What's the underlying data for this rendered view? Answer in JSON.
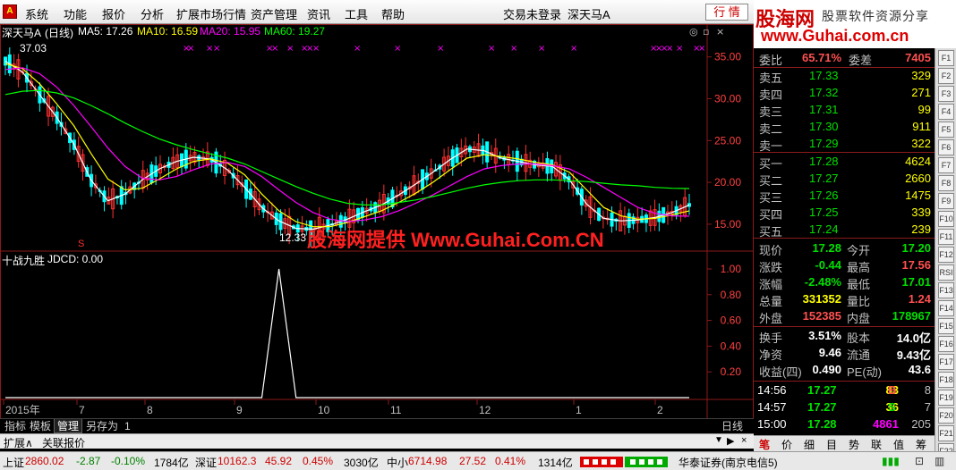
{
  "menu": {
    "app_icon": "A",
    "items": [
      "系统",
      "功能",
      "报价",
      "分析",
      "扩展市场行情",
      "资产管理",
      "资讯",
      "工具",
      "帮助"
    ],
    "trade_status": "交易未登录",
    "stock_name": "深天马A",
    "hq_button": "行 情"
  },
  "banner": {
    "logo": "股海网",
    "slogan": "股票软件资源分享",
    "url": "www.Guhai.com.cn"
  },
  "main_chart": {
    "stock_label": "深天马A",
    "period": "(日线)",
    "ma5_label": "MA5: 17.26",
    "ma10_label": "MA10: 16.59",
    "ma20_label": "MA20: 15.95",
    "ma60_label": "MA60: 19.27",
    "high_mark": "37.03",
    "low_mark": "12.33",
    "watermark": "股海网提供 Www.Guhai.Com.CN",
    "s_marker": "S"
  },
  "chart_data": [
    {
      "type": "line",
      "title": "深天马A (日线)",
      "y_ticks": [
        "35.00",
        "30.00",
        "25.00",
        "20.00",
        "15.00"
      ],
      "ylim": [
        12,
        37
      ],
      "x_ticks": [
        "2015年",
        "7",
        "8",
        "9",
        "10",
        "11",
        "12",
        "1",
        "2"
      ],
      "max_label": "37.03",
      "min_label": "12.33",
      "series": [
        {
          "name": "MA5",
          "color": "#ffffff",
          "values": [
            34.5,
            33.2,
            30.5,
            27.8,
            24.6,
            20.3,
            17.8,
            18.6,
            20.3,
            21.6,
            22.5,
            23.0,
            22.8,
            21.5,
            19.4,
            17.0,
            15.4,
            14.5,
            14.4,
            14.9,
            15.6,
            16.5,
            17.3,
            18.5,
            19.8,
            21.2,
            22.7,
            24.0,
            23.8,
            22.9,
            22.5,
            22.1,
            21.9,
            20.3,
            17.4,
            15.7,
            15.4,
            15.5,
            15.8,
            16.4,
            17.3
          ]
        },
        {
          "name": "MA10",
          "color": "#ffff00",
          "values": [
            34.2,
            33.6,
            31.8,
            29.4,
            26.8,
            23.5,
            20.4,
            19.1,
            19.3,
            20.4,
            21.6,
            22.5,
            22.8,
            22.3,
            20.9,
            18.6,
            16.6,
            15.3,
            14.7,
            14.7,
            15.2,
            15.9,
            16.6,
            17.6,
            18.7,
            20.0,
            21.5,
            22.9,
            23.3,
            23.1,
            22.8,
            22.4,
            22.1,
            21.2,
            19.1,
            17.0,
            16.0,
            15.6,
            15.7,
            16.1,
            16.6
          ]
        },
        {
          "name": "MA20",
          "color": "#ff00ff",
          "values": [
            33.5,
            33.7,
            33.0,
            31.4,
            29.2,
            26.7,
            24.1,
            21.9,
            20.5,
            20.3,
            20.7,
            21.5,
            22.2,
            22.4,
            21.9,
            20.7,
            19.1,
            17.6,
            16.4,
            15.6,
            15.3,
            15.5,
            15.9,
            16.6,
            17.5,
            18.5,
            19.6,
            20.7,
            21.6,
            22.0,
            22.2,
            22.2,
            22.0,
            21.6,
            20.6,
            19.4,
            18.2,
            17.0,
            16.3,
            16.0,
            15.95
          ]
        },
        {
          "name": "MA60",
          "color": "#00ff00",
          "values": [
            30.5,
            30.9,
            31.0,
            30.7,
            30.1,
            29.2,
            28.2,
            27.1,
            26.1,
            25.2,
            24.5,
            23.9,
            23.4,
            22.9,
            22.2,
            21.3,
            20.4,
            19.5,
            18.7,
            18.0,
            17.5,
            17.3,
            17.3,
            17.6,
            17.9,
            18.3,
            18.8,
            19.3,
            19.7,
            20.0,
            20.2,
            20.3,
            20.3,
            20.2,
            20.1,
            19.9,
            19.7,
            19.6,
            19.4,
            19.3,
            19.27
          ]
        }
      ]
    },
    {
      "type": "line",
      "title": "十战九胜 JDCD: 0.00",
      "y_ticks": [
        "1.00",
        "0.80",
        "0.60",
        "0.40",
        "0.20"
      ],
      "ylim": [
        0,
        1
      ],
      "series": [
        {
          "name": "JDCD",
          "color": "#ffffff",
          "values": [
            0,
            0,
            0,
            0,
            0,
            0,
            0,
            0,
            0,
            0,
            0,
            0,
            0,
            0,
            0,
            0,
            1.0,
            0,
            0,
            0,
            0,
            0,
            0,
            0,
            0,
            0,
            0,
            0,
            0,
            0,
            0,
            0,
            0,
            0,
            0,
            0,
            0,
            0,
            0,
            0,
            0
          ]
        }
      ]
    }
  ],
  "sub_chart": {
    "title": "十战九胜",
    "indicator": "JDCD: 0.00"
  },
  "quote": {
    "weibi_label": "委比",
    "weibi_value": "65.71%",
    "weicha_label": "委差",
    "weicha_value": "7405",
    "asks": [
      {
        "label": "卖五",
        "price": "17.33",
        "vol": "329"
      },
      {
        "label": "卖四",
        "price": "17.32",
        "vol": "271"
      },
      {
        "label": "卖三",
        "price": "17.31",
        "vol": "99"
      },
      {
        "label": "卖二",
        "price": "17.30",
        "vol": "911"
      },
      {
        "label": "卖一",
        "price": "17.29",
        "vol": "322"
      }
    ],
    "bids": [
      {
        "label": "买一",
        "price": "17.28",
        "vol": "4624"
      },
      {
        "label": "买二",
        "price": "17.27",
        "vol": "2660"
      },
      {
        "label": "买三",
        "price": "17.26",
        "vol": "1475"
      },
      {
        "label": "买四",
        "price": "17.25",
        "vol": "339"
      },
      {
        "label": "买五",
        "price": "17.24",
        "vol": "239"
      }
    ],
    "stats": [
      {
        "l1": "现价",
        "v1": "17.28",
        "l2": "今开",
        "v2": "17.20"
      },
      {
        "l1": "涨跌",
        "v1": "-0.44",
        "l2": "最高",
        "v2": "17.56"
      },
      {
        "l1": "涨幅",
        "v1": "-2.48%",
        "l2": "最低",
        "v2": "17.01"
      },
      {
        "l1": "总量",
        "v1": "331352",
        "l2": "量比",
        "v2": "1.24"
      },
      {
        "l1": "外盘",
        "v1": "152385",
        "l2": "内盘",
        "v2": "178967"
      }
    ],
    "fin": [
      {
        "l1": "换手",
        "v1": "3.51%",
        "l2": "股本",
        "v2": "14.0亿"
      },
      {
        "l1": "净资",
        "v1": "9.46",
        "l2": "流通",
        "v2": "9.43亿"
      },
      {
        "l1": "收益(四)",
        "v1": "0.490",
        "l2": "PE(动)",
        "v2": "43.6"
      }
    ],
    "ticks": [
      {
        "time": "14:56",
        "price": "17.27",
        "vol": "83",
        "flag": "B",
        "n": "8"
      },
      {
        "time": "14:57",
        "price": "17.27",
        "vol": "36",
        "flag": "S",
        "n": "7"
      },
      {
        "time": "15:00",
        "price": "17.28",
        "vol": "4861",
        "flag": "",
        "n": "205"
      }
    ]
  },
  "tabs": [
    "指标",
    "模板",
    "管理",
    "另存为",
    "1"
  ],
  "period_label": "日线",
  "ext_bar": {
    "ext": "扩展∧",
    "related": "关联报价"
  },
  "bottom_tabs": [
    "笔",
    "价",
    "细",
    "目",
    "势",
    "联",
    "值",
    "筹"
  ],
  "side_buttons": [
    "F1",
    "F2",
    "F3",
    "F4",
    "F5",
    "F6",
    "F7",
    "F8",
    "F9",
    "F10",
    "F11",
    "F12",
    "RSI",
    "F13",
    "F14",
    "F15",
    "F16",
    "F17",
    "F18",
    "F19",
    "F20",
    "F21",
    "F22"
  ],
  "status": {
    "sh_label": "上证",
    "sh_val": "2860.02",
    "sh_chg": "-2.87",
    "sh_pct": "-0.10%",
    "sh_amt": "1784亿",
    "sz_label": "深证",
    "sz_val": "10162.3",
    "sz_chg": "45.92",
    "sz_pct": "0.45%",
    "sz_amt": "3030亿",
    "zx_label": "中小",
    "zx_val": "6714.98",
    "zx_chg": "27.52",
    "zx_pct": "0.41%",
    "zx_amt": "1314亿",
    "broker": "华泰证券(南京电信5)"
  }
}
